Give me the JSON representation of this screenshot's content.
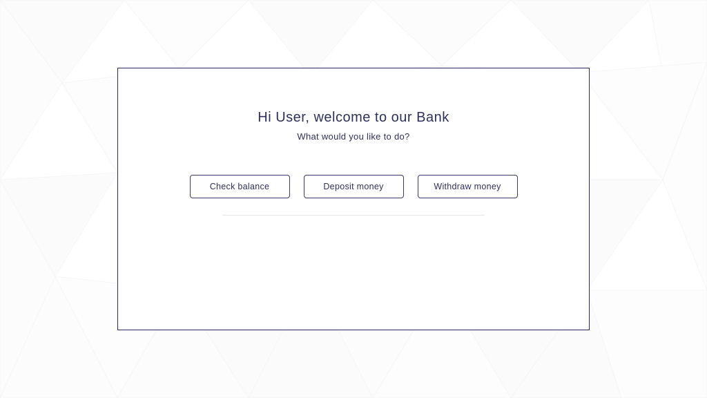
{
  "header": {
    "title": "Hi User, welcome to our Bank",
    "subtitle": "What would you like to do?"
  },
  "actions": {
    "check_balance": "Check balance",
    "deposit_money": "Deposit money",
    "withdraw_money": "Withdraw money"
  }
}
